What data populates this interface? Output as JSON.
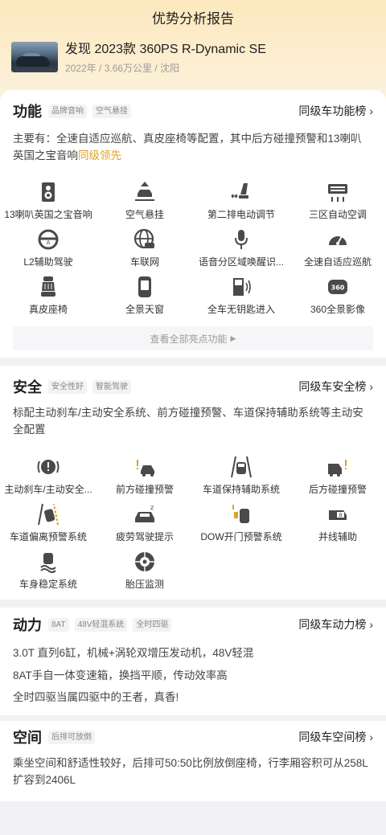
{
  "header": {
    "title": "优势分析报告"
  },
  "car": {
    "title": "发现 2023款 360PS R-Dynamic SE",
    "subtitle": "2022年 / 3.66万公里 / 沈阳"
  },
  "function": {
    "title": "功能",
    "tags": [
      "品牌音响",
      "空气悬挂"
    ],
    "rank_label": "同级车功能榜",
    "desc_main": "主要有：全速自适应巡航、真皮座椅等配置，其中后方碰撞预警和13喇叭英国之宝音响",
    "desc_highlight": "同级领先",
    "items": [
      {
        "label": "13喇叭英国之宝音响",
        "icon": "speaker-icon"
      },
      {
        "label": "空气悬挂",
        "icon": "air-suspension-icon"
      },
      {
        "label": "第二排电动调节",
        "icon": "power-seat-icon"
      },
      {
        "label": "三区自动空调",
        "icon": "climate-control-icon"
      },
      {
        "label": "L2辅助驾驶",
        "icon": "steering-assist-icon"
      },
      {
        "label": "车联网",
        "icon": "connected-car-icon"
      },
      {
        "label": "语音分区域唤醒识...",
        "icon": "microphone-icon"
      },
      {
        "label": "全速自适应巡航",
        "icon": "cruise-gauge-icon"
      },
      {
        "label": "真皮座椅",
        "icon": "leather-seat-icon"
      },
      {
        "label": "全景天窗",
        "icon": "sunroof-icon"
      },
      {
        "label": "全车无钥匙进入",
        "icon": "keyless-entry-icon"
      },
      {
        "label": "360全景影像",
        "icon": "camera-360-icon"
      }
    ],
    "all_label": "查看全部亮点功能"
  },
  "safety": {
    "title": "安全",
    "tags": [
      "安全性好",
      "智能驾驶"
    ],
    "rank_label": "同级车安全榜",
    "desc": "标配主动刹车/主动安全系统、前方碰撞预警、车道保持辅助系统等主动安全配置",
    "items": [
      {
        "label": "主动刹车/主动安全...",
        "icon": "brake-warning-icon"
      },
      {
        "label": "前方碰撞预警",
        "icon": "front-collision-icon"
      },
      {
        "label": "车道保持辅助系统",
        "icon": "lane-keep-icon"
      },
      {
        "label": "后方碰撞预警",
        "icon": "rear-collision-icon"
      },
      {
        "label": "车道偏离预警系统",
        "icon": "lane-departure-icon"
      },
      {
        "label": "疲劳驾驶提示",
        "icon": "fatigue-icon"
      },
      {
        "label": "DOW开门预警系统",
        "icon": "door-warning-icon"
      },
      {
        "label": "并线辅助",
        "icon": "blind-spot-icon"
      },
      {
        "label": "车身稳定系统",
        "icon": "stability-icon"
      },
      {
        "label": "胎压监测",
        "icon": "tire-pressure-icon"
      }
    ]
  },
  "power": {
    "title": "动力",
    "tags": [
      "8AT",
      "48V轻混系统",
      "全时四驱"
    ],
    "rank_label": "同级车动力榜",
    "lines": [
      "3.0T 直列6缸，机械+涡轮双增压发动机，48V轻混",
      "8AT手自一体变速箱，换挡平顺，传动效率高",
      "全时四驱当属四驱中的王者，真香!"
    ]
  },
  "space": {
    "title": "空间",
    "tags": [
      "后排可放倒"
    ],
    "rank_label": "同级车空间榜",
    "desc": "乘坐空间和舒适性较好，后排可50:50比例放倒座椅，行李厢容积可从258L扩容到2406L"
  }
}
